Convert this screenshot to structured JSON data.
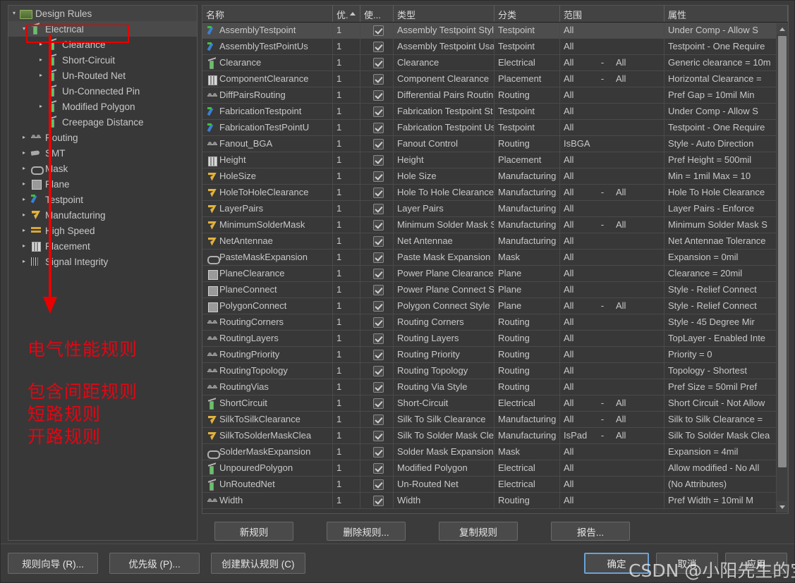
{
  "tree": {
    "root": {
      "label": "Design Rules",
      "icon": "folder-rules-icon",
      "expander": "collapse"
    },
    "items": [
      {
        "label": "Electrical",
        "icon": "electrical-icon",
        "indent": 1,
        "expander": "collapse",
        "selected": true
      },
      {
        "label": "Clearance",
        "icon": "electrical-icon",
        "indent": 2,
        "expander": "expand"
      },
      {
        "label": "Short-Circuit",
        "icon": "electrical-icon",
        "indent": 2,
        "expander": "expand"
      },
      {
        "label": "Un-Routed Net",
        "icon": "electrical-icon",
        "indent": 2,
        "expander": "expand"
      },
      {
        "label": "Un-Connected Pin",
        "icon": "electrical-icon",
        "indent": 2,
        "expander": "none"
      },
      {
        "label": "Modified Polygon",
        "icon": "electrical-icon",
        "indent": 2,
        "expander": "expand"
      },
      {
        "label": "Creepage Distance",
        "icon": "electrical-icon",
        "indent": 2,
        "expander": "none"
      },
      {
        "label": "Routing",
        "icon": "routing-icon",
        "indent": 1,
        "expander": "expand"
      },
      {
        "label": "SMT",
        "icon": "smt-icon",
        "indent": 1,
        "expander": "expand"
      },
      {
        "label": "Mask",
        "icon": "mask-icon",
        "indent": 1,
        "expander": "expand"
      },
      {
        "label": "Plane",
        "icon": "plane-icon",
        "indent": 1,
        "expander": "expand"
      },
      {
        "label": "Testpoint",
        "icon": "testpoint-icon",
        "indent": 1,
        "expander": "expand"
      },
      {
        "label": "Manufacturing",
        "icon": "manufacturing-icon",
        "indent": 1,
        "expander": "expand"
      },
      {
        "label": "High Speed",
        "icon": "high-speed-icon",
        "indent": 1,
        "expander": "expand"
      },
      {
        "label": "Placement",
        "icon": "placement-icon",
        "indent": 1,
        "expander": "expand"
      },
      {
        "label": "Signal Integrity",
        "icon": "signal-integrity-icon",
        "indent": 1,
        "expander": "expand"
      }
    ]
  },
  "annotation": {
    "color": "#e30613",
    "lines": [
      "电气性能规则",
      "包含间距规则",
      "短路规则",
      "开路规则"
    ]
  },
  "grid": {
    "columns": [
      {
        "key": "name",
        "label": "名称"
      },
      {
        "key": "pri",
        "label": "优.",
        "sorted": true
      },
      {
        "key": "en",
        "label": "使..."
      },
      {
        "key": "type",
        "label": "类型"
      },
      {
        "key": "cat",
        "label": "分类"
      },
      {
        "key": "scope",
        "label": "范围"
      },
      {
        "key": "attr",
        "label": "属性"
      }
    ],
    "rows": [
      {
        "icon": "testpoint-icon",
        "name": "AssemblyTestpoint",
        "pri": "1",
        "enabled": true,
        "type": "Assembly Testpoint Styl",
        "cat": "Testpoint",
        "scope1": "All",
        "scope2": "",
        "attr": "Under Comp - Allow    S",
        "selected": true
      },
      {
        "icon": "testpoint-icon",
        "name": "AssemblyTestPointUs",
        "pri": "1",
        "enabled": true,
        "type": "Assembly Testpoint Usa",
        "cat": "Testpoint",
        "scope1": "All",
        "scope2": "",
        "attr": "Testpoint - One Require"
      },
      {
        "icon": "electrical-icon",
        "name": "Clearance",
        "pri": "1",
        "enabled": true,
        "type": "Clearance",
        "cat": "Electrical",
        "scope1": "All",
        "scope2": "All",
        "attr": "Generic clearance = 10m"
      },
      {
        "icon": "placement-icon",
        "name": "ComponentClearance",
        "pri": "1",
        "enabled": true,
        "type": "Component Clearance",
        "cat": "Placement",
        "scope1": "All",
        "scope2": "All",
        "attr": "Horizontal Clearance ="
      },
      {
        "icon": "routing-icon",
        "name": "DiffPairsRouting",
        "pri": "1",
        "enabled": true,
        "type": "Differential Pairs Routin",
        "cat": "Routing",
        "scope1": "All",
        "scope2": "",
        "attr": "Pref Gap = 10mil    Min"
      },
      {
        "icon": "testpoint-icon",
        "name": "FabricationTestpoint",
        "pri": "1",
        "enabled": true,
        "type": "Fabrication Testpoint St",
        "cat": "Testpoint",
        "scope1": "All",
        "scope2": "",
        "attr": "Under Comp - Allow    S"
      },
      {
        "icon": "testpoint-icon",
        "name": "FabricationTestPointU",
        "pri": "1",
        "enabled": true,
        "type": "Fabrication Testpoint Us",
        "cat": "Testpoint",
        "scope1": "All",
        "scope2": "",
        "attr": "Testpoint - One Require"
      },
      {
        "icon": "routing-icon",
        "name": "Fanout_BGA",
        "pri": "1",
        "enabled": true,
        "type": "Fanout Control",
        "cat": "Routing",
        "scope1": "IsBGA",
        "scope2": "",
        "attr": "Style - Auto    Direction"
      },
      {
        "icon": "placement-icon",
        "name": "Height",
        "pri": "1",
        "enabled": true,
        "type": "Height",
        "cat": "Placement",
        "scope1": "All",
        "scope2": "",
        "attr": "Pref Height = 500mil"
      },
      {
        "icon": "manufacturing-icon",
        "name": "HoleSize",
        "pri": "1",
        "enabled": true,
        "type": "Hole Size",
        "cat": "Manufacturing",
        "scope1": "All",
        "scope2": "",
        "attr": "Min = 1mil    Max = 10"
      },
      {
        "icon": "manufacturing-icon",
        "name": "HoleToHoleClearance",
        "pri": "1",
        "enabled": true,
        "type": "Hole To Hole Clearance",
        "cat": "Manufacturing",
        "scope1": "All",
        "scope2": "All",
        "attr": "Hole To Hole Clearance"
      },
      {
        "icon": "manufacturing-icon",
        "name": "LayerPairs",
        "pri": "1",
        "enabled": true,
        "type": "Layer Pairs",
        "cat": "Manufacturing",
        "scope1": "All",
        "scope2": "",
        "attr": "Layer Pairs - Enforce"
      },
      {
        "icon": "manufacturing-icon",
        "name": "MinimumSolderMask",
        "pri": "1",
        "enabled": true,
        "type": "Minimum Solder Mask S",
        "cat": "Manufacturing",
        "scope1": "All",
        "scope2": "All",
        "attr": "Minimum Solder Mask S"
      },
      {
        "icon": "manufacturing-icon",
        "name": "NetAntennae",
        "pri": "1",
        "enabled": true,
        "type": "Net Antennae",
        "cat": "Manufacturing",
        "scope1": "All",
        "scope2": "",
        "attr": "Net Antennae Tolerance"
      },
      {
        "icon": "mask-icon",
        "name": "PasteMaskExpansion",
        "pri": "1",
        "enabled": true,
        "type": "Paste Mask Expansion",
        "cat": "Mask",
        "scope1": "All",
        "scope2": "",
        "attr": "Expansion = 0mil"
      },
      {
        "icon": "plane-icon",
        "name": "PlaneClearance",
        "pri": "1",
        "enabled": true,
        "type": "Power Plane Clearance",
        "cat": "Plane",
        "scope1": "All",
        "scope2": "",
        "attr": "Clearance = 20mil"
      },
      {
        "icon": "plane-icon",
        "name": "PlaneConnect",
        "pri": "1",
        "enabled": true,
        "type": "Power Plane Connect St",
        "cat": "Plane",
        "scope1": "All",
        "scope2": "",
        "attr": "Style - Relief Connect"
      },
      {
        "icon": "plane-icon",
        "name": "PolygonConnect",
        "pri": "1",
        "enabled": true,
        "type": "Polygon Connect Style",
        "cat": "Plane",
        "scope1": "All",
        "scope2": "All",
        "attr": "Style - Relief Connect"
      },
      {
        "icon": "routing-icon",
        "name": "RoutingCorners",
        "pri": "1",
        "enabled": true,
        "type": "Routing Corners",
        "cat": "Routing",
        "scope1": "All",
        "scope2": "",
        "attr": "Style - 45 Degree    Mir"
      },
      {
        "icon": "routing-icon",
        "name": "RoutingLayers",
        "pri": "1",
        "enabled": true,
        "type": "Routing Layers",
        "cat": "Routing",
        "scope1": "All",
        "scope2": "",
        "attr": "TopLayer - Enabled Inte"
      },
      {
        "icon": "routing-icon",
        "name": "RoutingPriority",
        "pri": "1",
        "enabled": true,
        "type": "Routing Priority",
        "cat": "Routing",
        "scope1": "All",
        "scope2": "",
        "attr": "Priority = 0"
      },
      {
        "icon": "routing-icon",
        "name": "RoutingTopology",
        "pri": "1",
        "enabled": true,
        "type": "Routing Topology",
        "cat": "Routing",
        "scope1": "All",
        "scope2": "",
        "attr": "Topology - Shortest"
      },
      {
        "icon": "routing-icon",
        "name": "RoutingVias",
        "pri": "1",
        "enabled": true,
        "type": "Routing Via Style",
        "cat": "Routing",
        "scope1": "All",
        "scope2": "",
        "attr": "Pref Size = 50mil    Pref"
      },
      {
        "icon": "electrical-icon",
        "name": "ShortCircuit",
        "pri": "1",
        "enabled": true,
        "type": "Short-Circuit",
        "cat": "Electrical",
        "scope1": "All",
        "scope2": "All",
        "attr": "Short Circuit - Not Allow"
      },
      {
        "icon": "manufacturing-icon",
        "name": "SilkToSilkClearance",
        "pri": "1",
        "enabled": true,
        "type": "Silk To Silk Clearance",
        "cat": "Manufacturing",
        "scope1": "All",
        "scope2": "All",
        "attr": "Silk to Silk Clearance ="
      },
      {
        "icon": "manufacturing-icon",
        "name": "SilkToSolderMaskClea",
        "pri": "1",
        "enabled": true,
        "type": "Silk To Solder Mask Clea",
        "cat": "Manufacturing",
        "scope1": "IsPad",
        "scope2": "All",
        "attr": "Silk To Solder Mask Clea"
      },
      {
        "icon": "mask-icon",
        "name": "SolderMaskExpansion",
        "pri": "1",
        "enabled": true,
        "type": "Solder Mask Expansion",
        "cat": "Mask",
        "scope1": "All",
        "scope2": "",
        "attr": "Expansion = 4mil"
      },
      {
        "icon": "electrical-icon",
        "name": "UnpouredPolygon",
        "pri": "1",
        "enabled": true,
        "type": "Modified Polygon",
        "cat": "Electrical",
        "scope1": "All",
        "scope2": "",
        "attr": "Allow modified - No  All"
      },
      {
        "icon": "electrical-icon",
        "name": "UnRoutedNet",
        "pri": "1",
        "enabled": true,
        "type": "Un-Routed Net",
        "cat": "Electrical",
        "scope1": "All",
        "scope2": "",
        "attr": "(No Attributes)"
      },
      {
        "icon": "routing-icon",
        "name": "Width",
        "pri": "1",
        "enabled": true,
        "type": "Width",
        "cat": "Routing",
        "scope1": "All",
        "scope2": "",
        "attr": "Pref Width = 10mil   M",
        "partial": true
      }
    ]
  },
  "rule_buttons": [
    {
      "label": "新规则",
      "name": "new-rule-button"
    },
    {
      "label": "删除规则...",
      "name": "delete-rule-button"
    },
    {
      "label": "复制规则",
      "name": "duplicate-rule-button"
    },
    {
      "label": "报告...",
      "name": "report-button"
    }
  ],
  "footer": {
    "left_buttons": [
      {
        "label": "规则向导 (R)...",
        "name": "rule-wizard-button"
      },
      {
        "label": "优先级 (P)...",
        "name": "priorities-button"
      },
      {
        "label": "创建默认规则 (C)",
        "name": "create-default-rules-button"
      }
    ],
    "right_buttons": [
      {
        "label": "确定",
        "name": "ok-button",
        "primary": true
      },
      {
        "label": "取消",
        "name": "cancel-button"
      },
      {
        "label": "应用",
        "name": "apply-button"
      }
    ]
  },
  "watermark": {
    "text": "CSDN @小阳先生的宝库"
  }
}
